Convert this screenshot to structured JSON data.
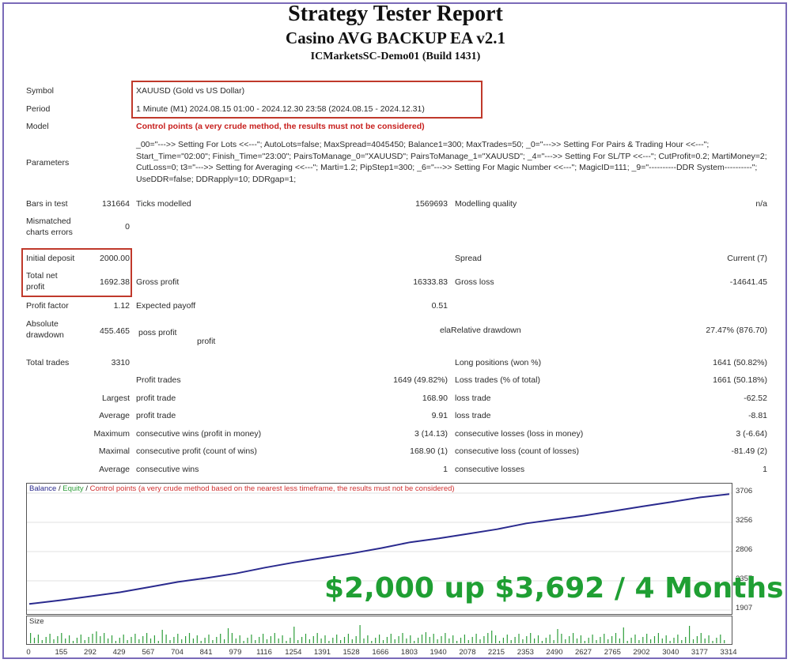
{
  "header": {
    "title": "Strategy Tester Report",
    "ea_name": "Casino AVG BACKUP EA v2.1",
    "account": "ICMarketsSC-Demo01 (Build 1431)"
  },
  "info": {
    "symbol_label": "Symbol",
    "symbol_value": "XAUUSD (Gold vs US Dollar)",
    "period_label": "Period",
    "period_value": "1 Minute (M1) 2024.08.15 01:00 - 2024.12.30 23:58 (2024.08.15 - 2024.12.31)",
    "model_label": "Model",
    "model_value": "Control points (a very crude method, the results must not be considered)",
    "parameters_label": "Parameters",
    "parameters_value": "_00=\"--->> Setting For Lots <<---\"; AutoLots=false; MaxSpread=4045450; Balance1=300; MaxTrades=50; _0=\"--->> Setting For Pairs & Trading Hour <<---\"; Start_Time=\"02:00\"; Finish_Time=\"23:00\"; PairsToManage_0=\"XAUUSD\"; PairsToManage_1=\"XAUUSD\"; _4=\"--->> Setting For SL/TP <<---\"; CutProfit=0.2; MartiMoney=2; CutLoss=0; t3=\"--->> Setting for Averaging <<---\"; Marti=1.2; PipStep1=300; _6=\"--->> Setting For Magic Number <<---\"; MagicID=111; _9=\"----------DDR System----------\"; UseDDR=false; DDRapply=10; DDRgap=1;"
  },
  "stats": {
    "bars_label": "Bars in test",
    "bars_value": "131664",
    "ticks_label": "Ticks modelled",
    "ticks_value": "1569693",
    "quality_label": "Modelling quality",
    "quality_value": "n/a",
    "mismatch_label": "Mismatched charts errors",
    "mismatch_value": "0",
    "deposit_label": "Initial deposit",
    "deposit_value": "2000.00",
    "spread_label": "Spread",
    "spread_value": "Current (7)",
    "net_label": "Total net profit",
    "net_value": "1692.38",
    "gross_profit_label": "Gross profit",
    "gross_profit_value": "16333.83",
    "gross_loss_label": "Gross loss",
    "gross_loss_value": "-14641.45",
    "pf_label": "Profit factor",
    "pf_value": "1.12",
    "payoff_label": "Expected payoff",
    "payoff_value": "0.51",
    "absdd_label": "Absolute drawdown",
    "absdd_value": "455.465",
    "absdd_mid_a": "poss profit",
    "absdd_mid_b": "profit",
    "reldd_label": "elaRelative drawdown",
    "reldd_value": "27.47% (876.70)",
    "trades_label": "Total trades",
    "trades_value": "3310",
    "long_label": "Long positions (won %)",
    "long_value": "1641 (50.82%)",
    "ptrades_label": "Profit trades",
    "ptrades_value": "1649 (49.82%)",
    "ltrades_label": "Loss trades (% of total)",
    "ltrades_value": "1661 (50.18%)",
    "largest_label": "Largest",
    "largest_p_label": "profit trade",
    "largest_p_value": "168.90",
    "largest_l_label": "loss trade",
    "largest_l_value": "-62.52",
    "average_label": "Average",
    "average_p_label": "profit trade",
    "average_p_value": "9.91",
    "average_l_label": "loss trade",
    "average_l_value": "-8.81",
    "maximum_label": "Maximum",
    "max_wins_label": "consecutive wins (profit in money)",
    "max_wins_value": "3 (14.13)",
    "max_losses_label": "consecutive losses (loss in money)",
    "max_losses_value": "3 (-6.64)",
    "maximal_label": "Maximal",
    "maximal_p_label": "consecutive profit (count of wins)",
    "maximal_p_value": "168.90 (1)",
    "maximal_l_label": "consecutive loss (count of losses)",
    "maximal_l_value": "-81.49 (2)",
    "avg_label": "Average",
    "avg_wins_label": "consecutive wins",
    "avg_wins_value": "1",
    "avg_losses_label": "consecutive losses",
    "avg_losses_value": "1"
  },
  "overlay_text": "$2,000 up $3,692 / 4 Months",
  "chart_data": {
    "type": "line",
    "legend": [
      {
        "name": "Balance",
        "color": "#2a2a8e"
      },
      {
        "name": "Equity",
        "color": "#2e9e3a"
      },
      {
        "name": "Control points (a very crude method based on the nearest less timeframe, the results must not be considered)",
        "color": "#d03030"
      }
    ],
    "y_ticks": [
      1907,
      2357,
      2806,
      3256,
      3706
    ],
    "x_ticks": [
      0,
      155,
      292,
      429,
      567,
      704,
      841,
      979,
      1116,
      1254,
      1391,
      1528,
      1666,
      1803,
      1940,
      2078,
      2215,
      2353,
      2490,
      2627,
      2765,
      2902,
      3040,
      3177,
      3314
    ],
    "ylim": [
      1907,
      3706
    ],
    "xlim": [
      0,
      3314
    ],
    "series": [
      {
        "name": "Balance",
        "x": [
          0,
          155,
          292,
          429,
          567,
          704,
          841,
          979,
          1116,
          1254,
          1391,
          1528,
          1666,
          1803,
          1940,
          2078,
          2215,
          2353,
          2490,
          2627,
          2765,
          2902,
          3040,
          3177,
          3314
        ],
        "values": [
          2000,
          2060,
          2120,
          2180,
          2260,
          2340,
          2400,
          2470,
          2560,
          2640,
          2710,
          2780,
          2860,
          2950,
          3010,
          3080,
          3150,
          3240,
          3300,
          3360,
          3430,
          3500,
          3570,
          3640,
          3692
        ]
      }
    ],
    "size_label": "Size"
  }
}
